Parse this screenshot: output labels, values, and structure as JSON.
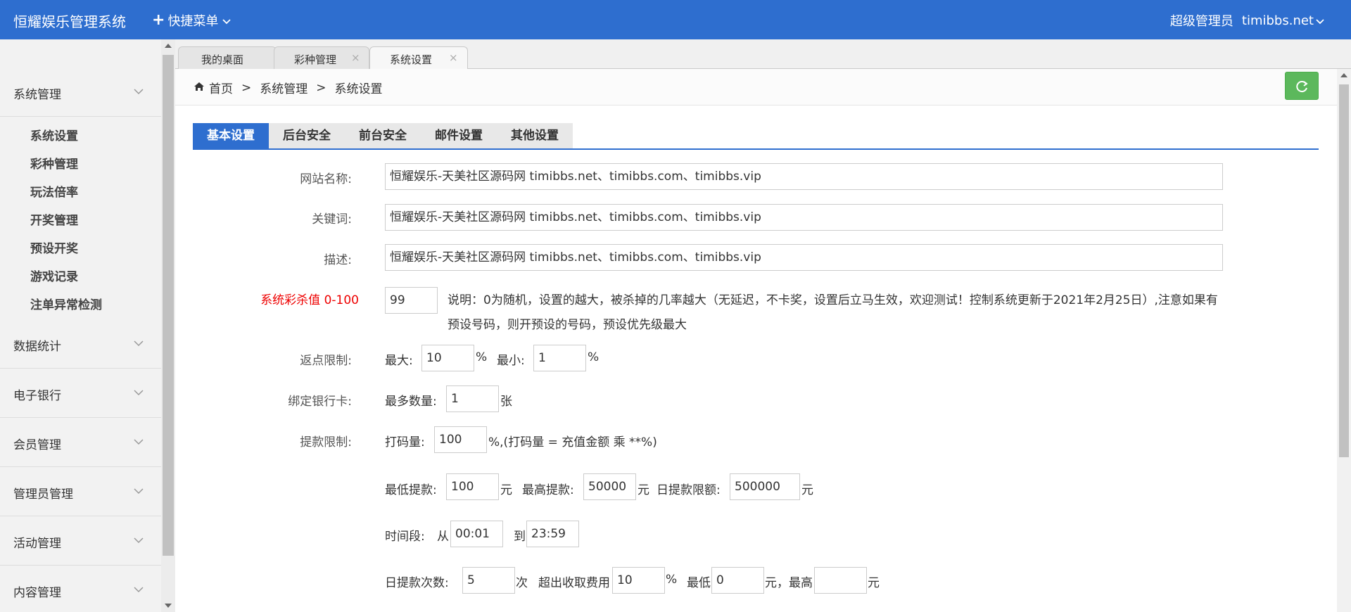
{
  "header": {
    "app_title": "恒耀娱乐管理系统",
    "quick_menu": "快捷菜单",
    "role": "超级管理员",
    "user": "timibbs.net"
  },
  "sidebar": {
    "groups": [
      {
        "label": "系统管理"
      },
      {
        "label": "数据统计"
      },
      {
        "label": "电子银行"
      },
      {
        "label": "会员管理"
      },
      {
        "label": "管理员管理"
      },
      {
        "label": "活动管理"
      },
      {
        "label": "内容管理"
      }
    ],
    "sub_items": [
      "系统设置",
      "彩种管理",
      "玩法倍率",
      "开奖管理",
      "预设开奖",
      "游戏记录",
      "注单异常检测"
    ]
  },
  "tabs": [
    {
      "label": "我的桌面"
    },
    {
      "label": "彩种管理"
    },
    {
      "label": "系统设置"
    }
  ],
  "breadcrumb": {
    "home": "首页",
    "sep": ">",
    "level1": "系统管理",
    "level2": "系统设置"
  },
  "settings_tabs": [
    "基本设置",
    "后台安全",
    "前台安全",
    "邮件设置",
    "其他设置"
  ],
  "form": {
    "site_name": {
      "label": "网站名称:",
      "value": "恒耀娱乐-天美社区源码网 timibbs.net、timibbs.com、timibbs.vip"
    },
    "keywords": {
      "label": "关键词:",
      "value": "恒耀娱乐-天美社区源码网 timibbs.net、timibbs.com、timibbs.vip"
    },
    "description": {
      "label": "描述:",
      "value": "恒耀娱乐-天美社区源码网 timibbs.net、timibbs.com、timibbs.vip"
    },
    "kill_rate": {
      "label": "系统彩杀值 0-100",
      "value": "99",
      "note": "说明：0为随机，设置的越大，被杀掉的几率越大（无延迟，不卡奖，设置后立马生效，欢迎测试！控制系统更新于2021年2月25日）,注意如果有预设号码，则开预设的号码，预设优先级最大"
    },
    "rebate": {
      "label": "返点限制:",
      "max_label": "最大:",
      "max_value": "10",
      "min_label": "最小:",
      "min_value": "1",
      "unit": "%"
    },
    "bank_card": {
      "label": "绑定银行卡:",
      "max_label": "最多数量:",
      "value": "1",
      "unit": "张"
    },
    "withdraw": {
      "label": "提款限制:",
      "bet_label": "打码量:",
      "bet_value": "100",
      "bet_note": "%,(打码量 = 充值金额 乘 **%)",
      "min_label": "最低提款:",
      "min_value": "100",
      "yuan": "元",
      "max_label": "最高提款:",
      "max_value": "50000",
      "daily_label": "日提款限额:",
      "daily_value": "500000",
      "time_label": "时间段:",
      "from": "从",
      "from_value": "00:01",
      "to": "到",
      "to_value": "23:59",
      "times_label": "日提款次数:",
      "times_value": "5",
      "times_unit": "次",
      "fee_label": "超出收取费用",
      "fee_value": "10",
      "pct": "%",
      "low_label": "最低",
      "low_value": "0",
      "yuan_comma": "元，最高",
      "high_value": ""
    }
  }
}
